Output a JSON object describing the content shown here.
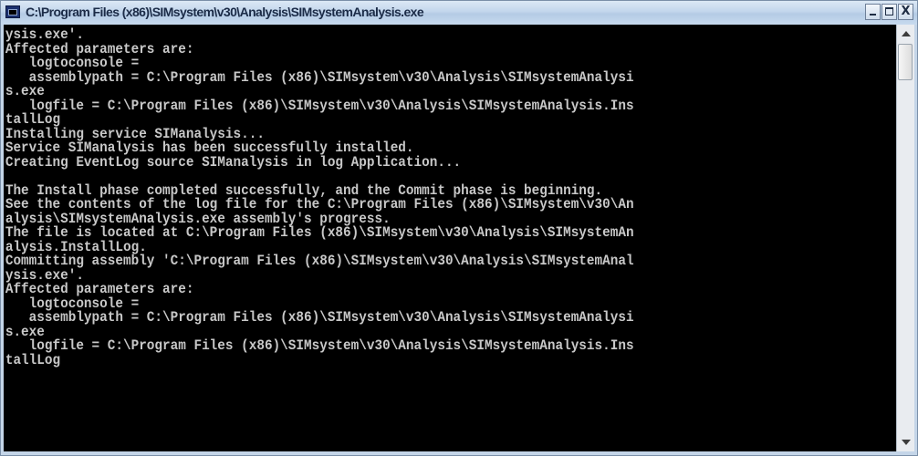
{
  "window": {
    "title": "C:\\Program Files (x86)\\SIMsystem\\v30\\Analysis\\SIMsystemAnalysis.exe",
    "controls": {
      "minimize": "_",
      "maximize": "□",
      "close": "X"
    }
  },
  "console": {
    "lines": [
      "ysis.exe'.",
      "Affected parameters are:",
      "   logtoconsole =",
      "   assemblypath = C:\\Program Files (x86)\\SIMsystem\\v30\\Analysis\\SIMsystemAnalysi",
      "s.exe",
      "   logfile = C:\\Program Files (x86)\\SIMsystem\\v30\\Analysis\\SIMsystemAnalysis.Ins",
      "tallLog",
      "Installing service SIManalysis...",
      "Service SIManalysis has been successfully installed.",
      "Creating EventLog source SIManalysis in log Application...",
      "",
      "The Install phase completed successfully, and the Commit phase is beginning.",
      "See the contents of the log file for the C:\\Program Files (x86)\\SIMsystem\\v30\\An",
      "alysis\\SIMsystemAnalysis.exe assembly's progress.",
      "The file is located at C:\\Program Files (x86)\\SIMsystem\\v30\\Analysis\\SIMsystemAn",
      "alysis.InstallLog.",
      "Committing assembly 'C:\\Program Files (x86)\\SIMsystem\\v30\\Analysis\\SIMsystemAnal",
      "ysis.exe'.",
      "Affected parameters are:",
      "   logtoconsole =",
      "   assemblypath = C:\\Program Files (x86)\\SIMsystem\\v30\\Analysis\\SIMsystemAnalysi",
      "s.exe",
      "   logfile = C:\\Program Files (x86)\\SIMsystem\\v30\\Analysis\\SIMsystemAnalysis.Ins",
      "tallLog"
    ]
  },
  "colors": {
    "console_background": "#000000",
    "console_text": "#c8c8c8",
    "titlebar": "#c4d5e8"
  },
  "icons": {
    "app": "console-app-icon",
    "scroll_up": "scroll-up-arrow-icon",
    "scroll_down": "scroll-down-arrow-icon"
  }
}
